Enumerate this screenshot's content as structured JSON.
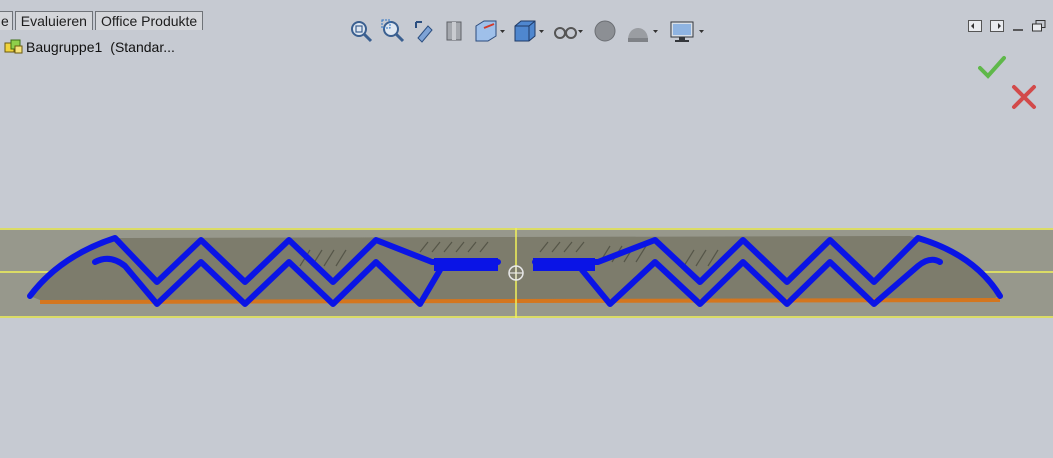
{
  "tabs": [
    "e",
    "Evaluieren",
    "Office Produkte"
  ],
  "tree": {
    "name": "Baugruppe1",
    "config": "(Standar..."
  },
  "toolbar": [
    "zoom-to-fit-icon",
    "zoom-area-icon",
    "previous-view-icon",
    "section-view-icon",
    "view-orientation-icon",
    "display-style-icon",
    "hide-show-items-icon",
    "edit-appearance-icon",
    "apply-scene-icon",
    "view-settings-icon"
  ],
  "colors": {
    "background": "#c6cad2",
    "profile": "#0a14e6",
    "band": "#8e8f80",
    "guide": "#f2f25a",
    "accent": "#d4761e",
    "ok": "#5fb84a",
    "cancel": "#d24a4a"
  }
}
